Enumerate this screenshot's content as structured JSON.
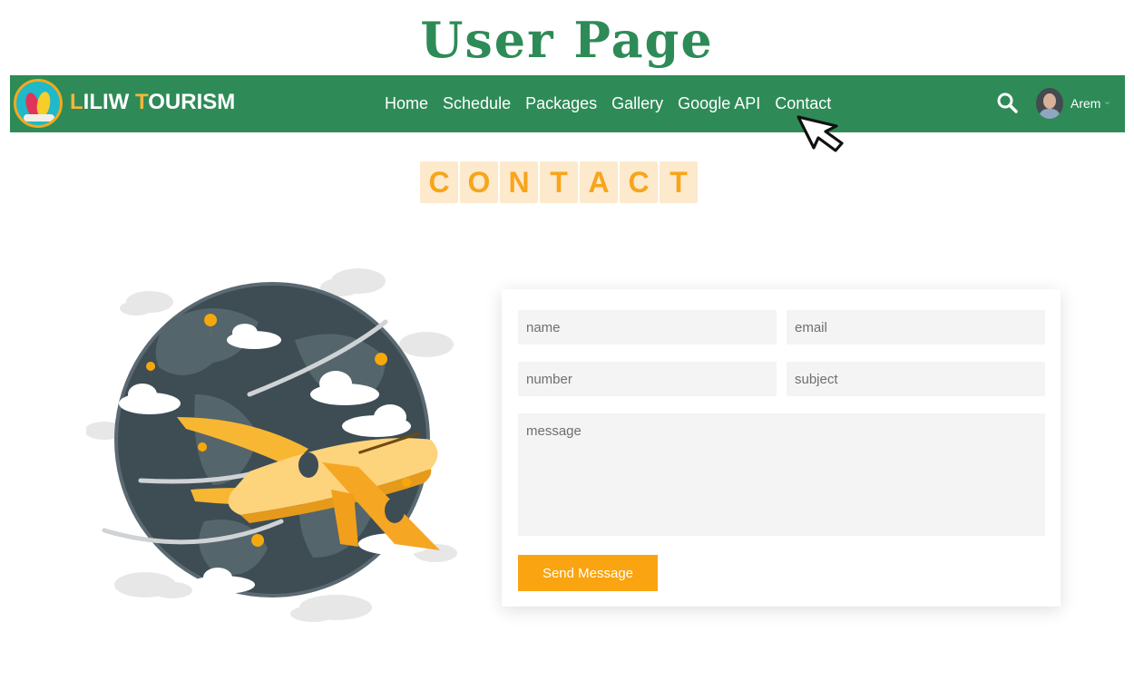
{
  "page_title": "User Page",
  "navbar": {
    "brand": {
      "initial1": "L",
      "rest1": "ILIW ",
      "initial2": "T",
      "rest2": "OURISM"
    },
    "links": [
      "Home",
      "Schedule",
      "Packages",
      "Gallery",
      "Google API",
      "Contact"
    ],
    "user": {
      "name": "Arem",
      "chevron": "⌄"
    }
  },
  "section": {
    "heading_letters": [
      "C",
      "O",
      "N",
      "T",
      "A",
      "C",
      "T"
    ]
  },
  "form": {
    "name_placeholder": "name",
    "email_placeholder": "email",
    "number_placeholder": "number",
    "subject_placeholder": "subject",
    "message_placeholder": "message",
    "submit_label": "Send Message"
  },
  "colors": {
    "title": "#2e8b57",
    "navbar": "#2e8b57",
    "brand_accent": "#f6b53a",
    "heading_tile": "#fde9cc",
    "heading_text": "#f7a51c",
    "button": "#f9a410",
    "input_bg": "#f4f4f4"
  },
  "icons": [
    "search-icon",
    "user-avatar",
    "chevron-down-icon",
    "pointer-cursor-icon",
    "globe-airplane-illustration"
  ]
}
